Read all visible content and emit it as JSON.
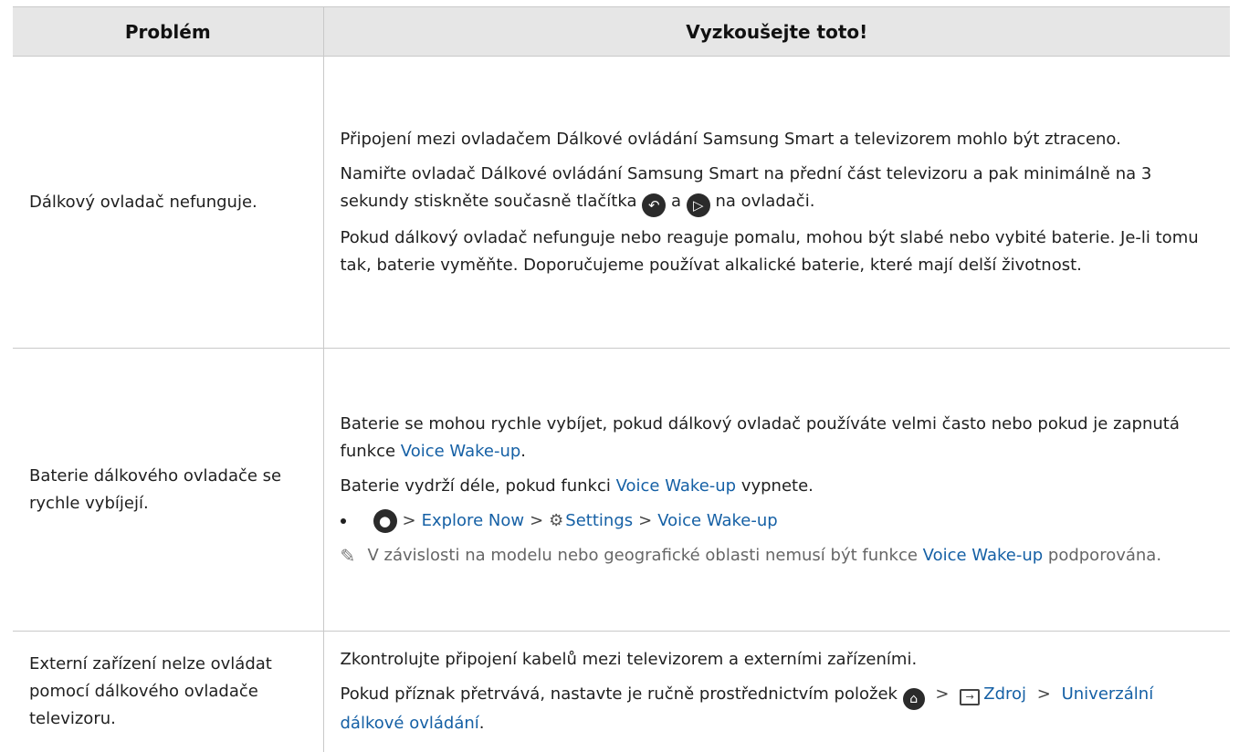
{
  "headers": {
    "problem": "Problém",
    "solution": "Vyzkoušejte toto!"
  },
  "rows": [
    {
      "problem": "Dálkový ovladač nefunguje.",
      "p1": "Připojení mezi ovladačem Dálkové ovládání Samsung Smart a televizorem mohlo být ztraceno.",
      "p2_a": "Namiřte ovladač Dálkové ovládání Samsung Smart na přední část televizoru a pak minimálně na 3 sekundy stiskněte současně tlačítka",
      "p2_and": "a",
      "p2_b": "na ovladači.",
      "p3": "Pokud dálkový ovladač nefunguje nebo reaguje pomalu, mohou být slabé nebo vybité baterie. Je-li tomu tak, baterie vyměňte. Doporučujeme používat alkalické baterie, které mají delší životnost."
    },
    {
      "problem": "Baterie dálkového ovladače se rychle vybíjejí.",
      "p1_a": "Baterie se mohou rychle vybíjet, pokud dálkový ovladač používáte velmi často nebo pokud je zapnutá funkce",
      "p1_link": "Voice Wake-up",
      "p1_end": ".",
      "p2_a": "Baterie vydrží déle, pokud funkci",
      "p2_link": "Voice Wake-up",
      "p2_b": "vypnete.",
      "path": {
        "step1": "Explore Now",
        "step2": "Settings",
        "step3": "Voice Wake-up"
      },
      "note_a": "V závislosti na modelu nebo geografické oblasti nemusí být funkce",
      "note_link": "Voice Wake-up",
      "note_b": "podporována."
    },
    {
      "problem": "Externí zařízení nelze ovládat pomocí dálkového ovladače televizoru.",
      "p1": "Zkontrolujte připojení kabelů mezi televizorem a externími zařízeními.",
      "p2_a": "Pokud příznak přetrvává, nastavte je ručně prostřednictvím položek",
      "p2_link1": "Zdroj",
      "p2_link2": "Univerzální dálkové ovládání",
      "p2_end": "."
    }
  ],
  "icons": {
    "back": "back-icon",
    "play_pause": "play-pause-icon",
    "mic": "microphone-icon",
    "settings": "gear-icon",
    "home": "home-icon",
    "source": "source-icon",
    "note": "pencil-icon"
  },
  "colors": {
    "link": "#1560a5",
    "header_bg": "#e6e6e6"
  }
}
